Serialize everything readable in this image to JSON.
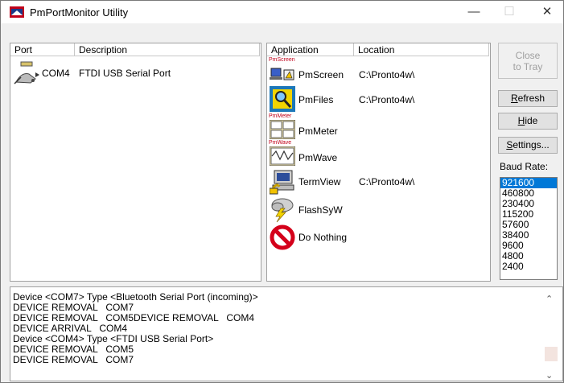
{
  "window": {
    "title": "PmPortMonitor Utility"
  },
  "titlebar": {
    "minimize": "—",
    "maximize": "☐",
    "close": "✕"
  },
  "ports": {
    "columns": [
      "Port",
      "Description"
    ],
    "rows": [
      {
        "port": "COM4",
        "description": "FTDI USB Serial Port"
      }
    ]
  },
  "applications": {
    "columns": [
      "Application",
      "Location"
    ],
    "rows": [
      {
        "name": "PmScreen",
        "location": "C:\\Pronto4w\\",
        "icon": "pmscreen-icon",
        "caption": "PmScreen"
      },
      {
        "name": "PmFiles",
        "location": "C:\\Pronto4w\\",
        "icon": "pmfiles-icon",
        "caption": ""
      },
      {
        "name": "PmMeter",
        "location": "",
        "icon": "pmmeter-icon",
        "caption": "PmMeter"
      },
      {
        "name": "PmWave",
        "location": "",
        "icon": "pmwave-icon",
        "caption": "PmWave"
      },
      {
        "name": "TermView",
        "location": "C:\\Pronto4w\\",
        "icon": "termview-icon",
        "caption": ""
      },
      {
        "name": "FlashSyW",
        "location": "",
        "icon": "flashsyw-icon",
        "caption": ""
      },
      {
        "name": "Do Nothing",
        "location": "",
        "icon": "do-nothing-icon",
        "caption": ""
      }
    ]
  },
  "buttons": {
    "close_to_tray_1": "Close",
    "close_to_tray_2": "to Tray",
    "refresh_first": "R",
    "refresh_rest": "efresh",
    "hide_first": "H",
    "hide_rest": "ide",
    "settings_first": "S",
    "settings_rest": "ettings..."
  },
  "baud": {
    "label": "Baud Rate:",
    "options": [
      "921600",
      "460800",
      "230400",
      "115200",
      "57600",
      "38400",
      "9600",
      "4800",
      "2400"
    ],
    "selected": "921600"
  },
  "log": {
    "lines": [
      "Device <COM7> Type <Bluetooth Serial Port (incoming)>",
      "DEVICE REMOVAL   COM7",
      "DEVICE REMOVAL   COM5DEVICE REMOVAL   COM4",
      "DEVICE ARRIVAL   COM4",
      "Device <COM4> Type <FTDI USB Serial Port>",
      "DEVICE REMOVAL   COM5",
      "DEVICE REMOVAL   COM7"
    ]
  },
  "colors": {
    "selection": "#0078d7",
    "accent": "#c0001a"
  }
}
